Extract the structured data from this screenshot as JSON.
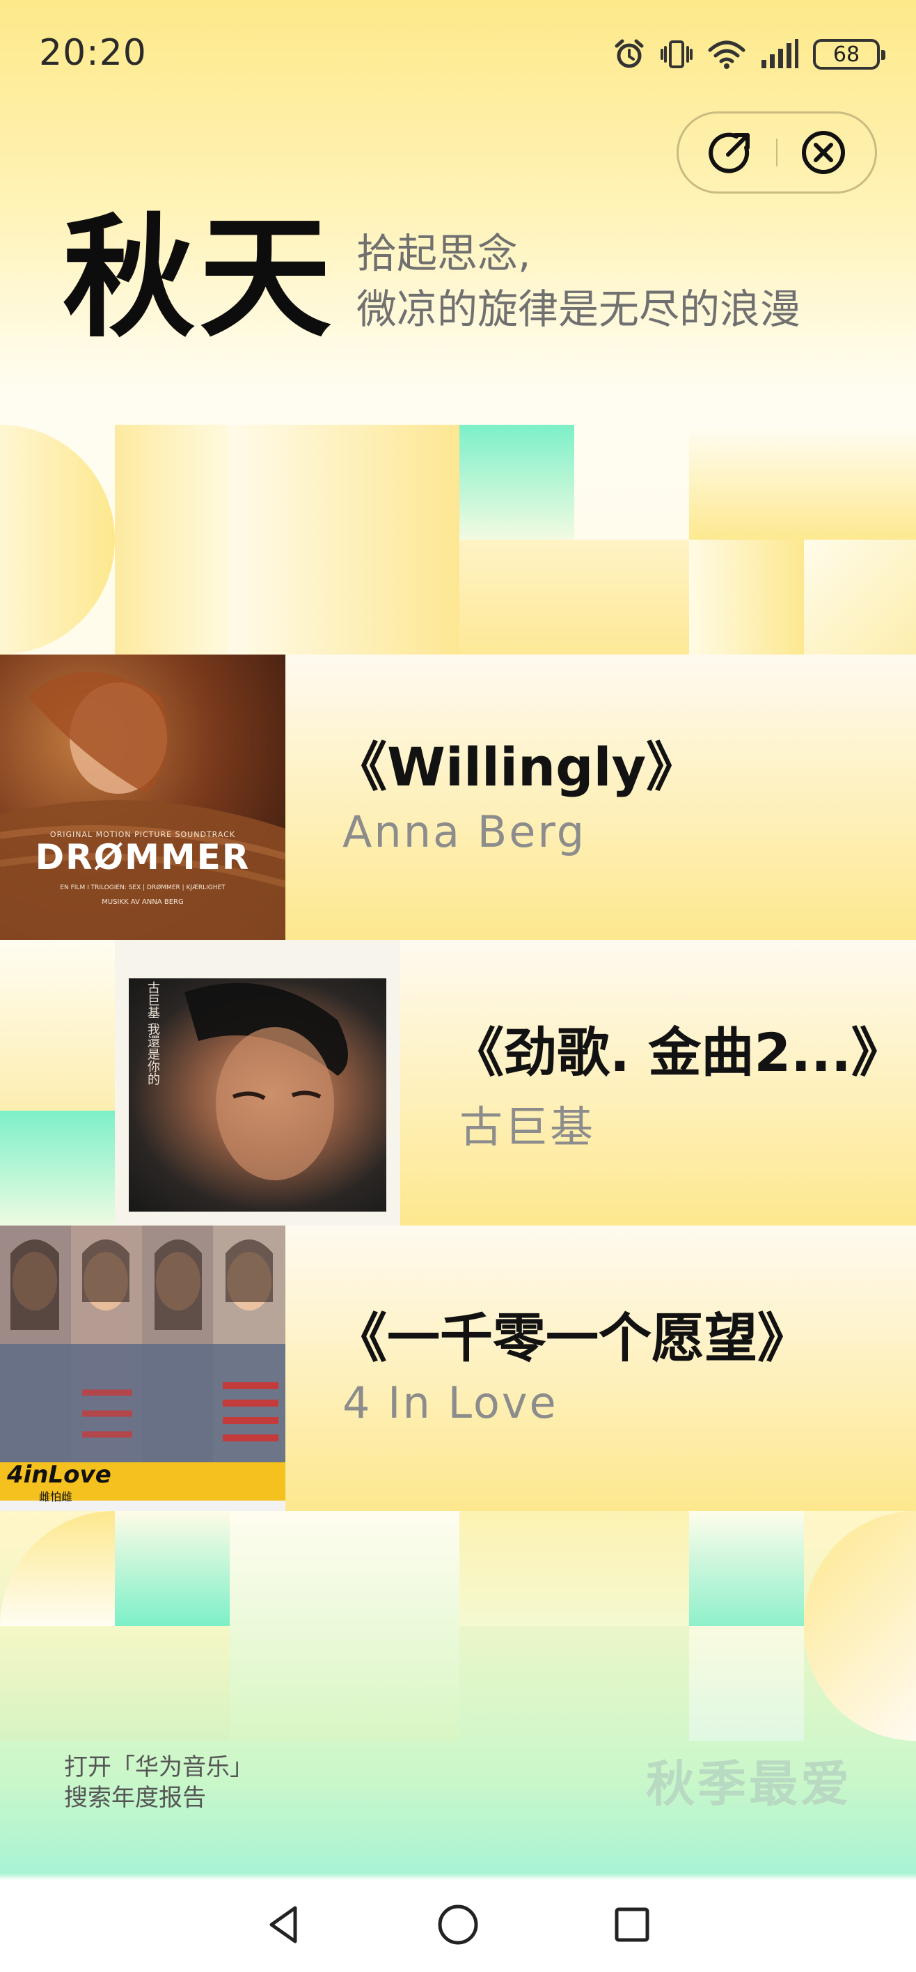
{
  "status_bar": {
    "time": "20:20",
    "battery": "68",
    "icons": [
      "alarm-icon",
      "vibrate-icon",
      "wifi-icon",
      "signal-icon",
      "battery-icon"
    ]
  },
  "actions": {
    "share_icon": "share-icon",
    "close_icon": "close-icon"
  },
  "hero": {
    "title": "秋天",
    "subtitle_line1": "拾起思念,",
    "subtitle_line2": "微凉的旋律是无尽的浪漫"
  },
  "songs": [
    {
      "title": "《Willingly》",
      "artist": "Anna Berg",
      "cover_text": "DRØMMER",
      "cover_top_text": "ORIGINAL MOTION PICTURE SOUNDTRACK",
      "cover_small_text": "EN FILM I TRILOGIEN: SEX | DRØMMER | KJÆRLIGHET",
      "cover_bottom_text": "MUSIKK AV ANNA BERG"
    },
    {
      "title": "《劲歌. 金曲2...》",
      "artist": "古巨基",
      "cover_text": "古巨基 我還是你的"
    },
    {
      "title": "《一千零一个愿望》",
      "artist": "4 In Love",
      "cover_text": "4inLove",
      "cover_sub_text": "雌怕雌"
    }
  ],
  "footer": {
    "hint_line1": "打开「华为音乐」",
    "hint_line2": "搜索年度报告",
    "tag": "秋季最爱"
  },
  "nav": {
    "back_icon": "back-triangle-icon",
    "home_icon": "home-circle-icon",
    "recents_icon": "recents-square-icon"
  },
  "colors": {
    "accent_yellow": "#fde98a",
    "accent_mint": "#7cf0c8",
    "text_dark": "#121212",
    "text_grey": "#8c8c8c"
  }
}
